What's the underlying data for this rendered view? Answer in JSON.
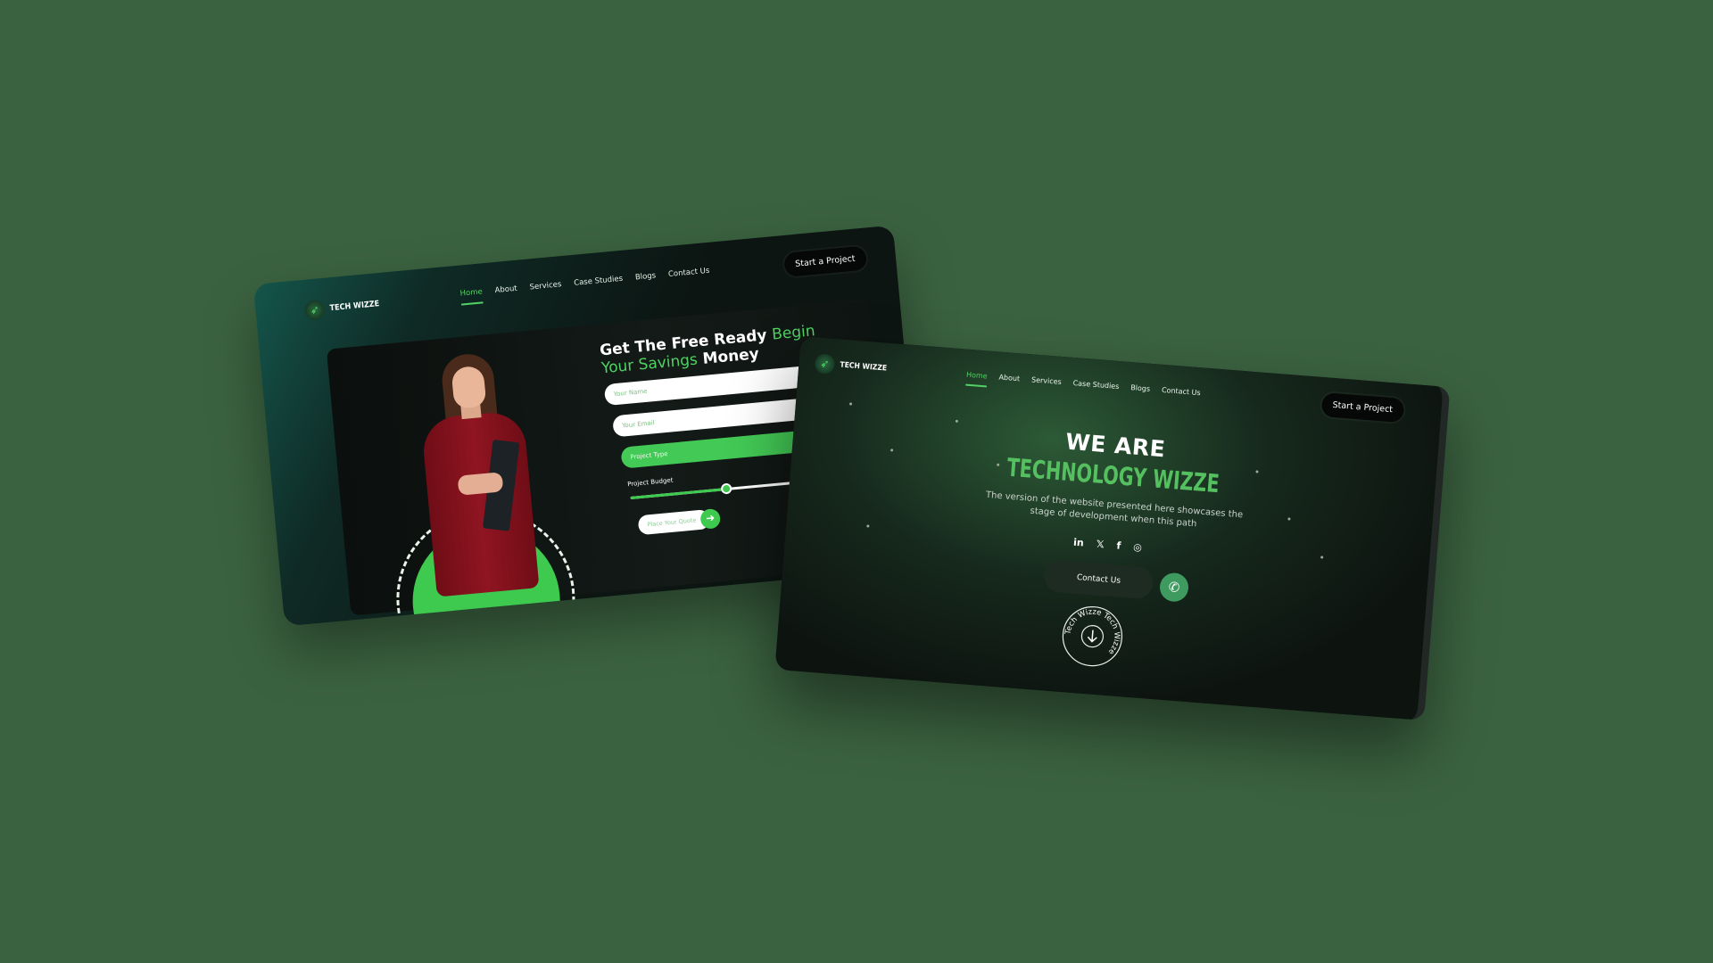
{
  "screen1": {
    "brand": "TECH WIZZE",
    "nav": [
      "Home",
      "About",
      "Services",
      "Case Studies",
      "Blogs",
      "Contact Us"
    ],
    "cta": "Start a Project",
    "title_part1": "Get The Free Ready ",
    "title_part2": "Begin",
    "title_part3": "Your Savings",
    "title_part4": " Money",
    "fields": {
      "name_placeholder": "Your Name",
      "email_placeholder": "Your Email",
      "project_type": "Project Type"
    },
    "budget_label": "Project Budget",
    "budget_fraction": 0.6,
    "quote_placeholder": "Place Your Quote"
  },
  "screen2": {
    "brand": "TECH WIZZE",
    "nav": [
      "Home",
      "About",
      "Services",
      "Case Studies",
      "Blogs",
      "Contact Us"
    ],
    "cta": "Start a Project",
    "headline": "WE ARE",
    "subheadline": "TECHNOLOGY WIZZE",
    "description": "The version of the website presented here showcases the stage of development when this path",
    "socials": [
      "in",
      "𝕏",
      "f",
      "◎"
    ],
    "contact_button": "Contact Us",
    "badge_text": "Tech Wizze Tech Wizze"
  },
  "colors": {
    "background": "#3b6240",
    "accent": "#4fd262",
    "dark": "#0c1512"
  },
  "icons": {
    "logo": "tech-wizze-logo-icon",
    "arrow": "arrow-right-icon",
    "whatsapp": "whatsapp-icon",
    "scroll_down": "arrow-down-icon"
  }
}
